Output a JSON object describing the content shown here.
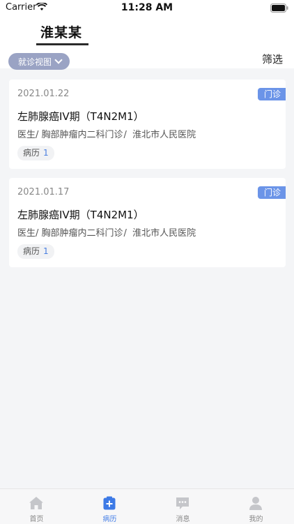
{
  "status_bar": {
    "carrier": "Carrier",
    "time": "11:28 AM"
  },
  "header": {
    "patient_name": "淮某某",
    "view_dropdown_label": "就诊视图",
    "filter_label": "筛选"
  },
  "colors": {
    "accent": "#3d7ae6",
    "badge": "#6b94e8",
    "dropdown": "#9aa3c4",
    "background": "#f4f5f7"
  },
  "records": [
    {
      "date": "2021.01.22",
      "badge": "门诊",
      "diagnosis": "左肺腺癌IV期（T4N2M1）",
      "doctor": "医生/",
      "department": "胸部肿瘤内二科门诊",
      "department_sep": "/",
      "hospital": "淮北市人民医院",
      "record_label": "病历",
      "record_count": "1"
    },
    {
      "date": "2021.01.17",
      "badge": "门诊",
      "diagnosis": "左肺腺癌IV期（T4N2M1）",
      "doctor": "医生/",
      "department": "胸部肿瘤内二科门诊",
      "department_sep": "/",
      "hospital": "淮北市人民医院",
      "record_label": "病历",
      "record_count": "1"
    }
  ],
  "tab_bar": {
    "tabs": [
      {
        "label": "首页",
        "icon": "home-icon"
      },
      {
        "label": "病历",
        "icon": "medical-record-icon",
        "active": true
      },
      {
        "label": "消息",
        "icon": "message-icon"
      },
      {
        "label": "我的",
        "icon": "profile-icon"
      }
    ]
  }
}
